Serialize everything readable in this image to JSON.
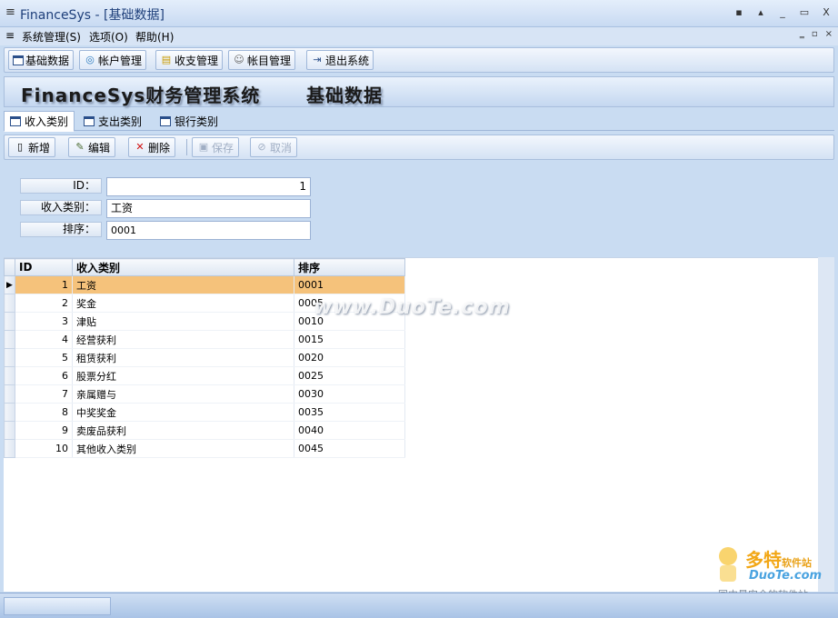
{
  "window": {
    "title": "FinanceSys - [基础数据]",
    "controls": [
      "▪",
      "▴",
      "_",
      "▭",
      "X"
    ]
  },
  "menu": {
    "items": [
      "系统管理(S)",
      "选项(O)",
      "帮助(H)"
    ],
    "mdi_controls": [
      "‗",
      "▫",
      "×"
    ]
  },
  "toolbar": {
    "items": [
      "基础数据",
      "帐户管理",
      "收支管理",
      "帐目管理",
      "退出系统"
    ]
  },
  "banner": {
    "app_title": "FinanceSys财务管理系统",
    "page_title": "基础数据"
  },
  "tabs": [
    "收入类别",
    "支出类别",
    "银行类别"
  ],
  "actions": {
    "add": "新增",
    "edit": "编辑",
    "delete": "删除",
    "save": "保存",
    "cancel": "取消"
  },
  "form": {
    "id_label": "ID：",
    "id_value": "1",
    "category_label": "收入类别：",
    "category_value": "工资",
    "order_label": "排序：",
    "order_value": "0001"
  },
  "grid": {
    "columns": [
      "ID",
      "收入类别",
      "排序"
    ],
    "rows": [
      {
        "id": "1",
        "name": "工资",
        "order": "0001"
      },
      {
        "id": "2",
        "name": "奖金",
        "order": "0005"
      },
      {
        "id": "3",
        "name": "津贴",
        "order": "0010"
      },
      {
        "id": "4",
        "name": "经营获利",
        "order": "0015"
      },
      {
        "id": "5",
        "name": "租赁获利",
        "order": "0020"
      },
      {
        "id": "6",
        "name": "股票分红",
        "order": "0025"
      },
      {
        "id": "7",
        "name": "亲属赠与",
        "order": "0030"
      },
      {
        "id": "8",
        "name": "中奖奖金",
        "order": "0035"
      },
      {
        "id": "9",
        "name": "卖废品获利",
        "order": "0040"
      },
      {
        "id": "10",
        "name": "其他收入类别",
        "order": "0045"
      }
    ],
    "selected_marker": "▶"
  },
  "watermark": {
    "text": "www.DuoTe.com",
    "brand": "多特",
    "brand_sub": "软件站",
    "brand_url": "DuoTe.com",
    "tagline": "国内最安全的软件站"
  }
}
